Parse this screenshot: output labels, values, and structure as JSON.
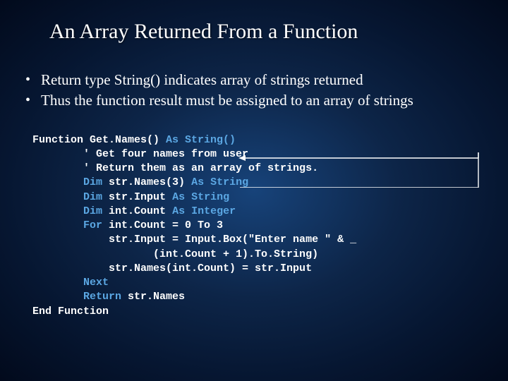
{
  "title": "An Array Returned From a Function",
  "bullets": [
    "Return type String() indicates array of strings returned",
    "Thus the function result must be assigned to an array of strings"
  ],
  "code": {
    "l1a": "Function Get.Names() ",
    "l1b": "As String()",
    "l2": "        ' Get four names from user",
    "l3": "        ' Return them as an array of strings.",
    "l4a": "        ",
    "l4b": "Dim",
    "l4c": " str.Names(3) ",
    "l4d": "As String",
    "l5a": "        ",
    "l5b": "Dim",
    "l5c": " str.Input ",
    "l5d": "As String",
    "l6a": "        ",
    "l6b": "Dim",
    "l6c": " int.Count ",
    "l6d": "As Integer",
    "l7a": "        ",
    "l7b": "For",
    "l7c": " int.Count = 0 To 3",
    "l8": "            str.Input = Input.Box(\"Enter name \" & _",
    "l9": "                   (int.Count + 1).To.String)",
    "l10": "            str.Names(int.Count) = str.Input",
    "l11a": "        ",
    "l11b": "Next",
    "l12a": "        ",
    "l12b": "Return",
    "l12c": " str.Names",
    "l13": "End Function"
  }
}
